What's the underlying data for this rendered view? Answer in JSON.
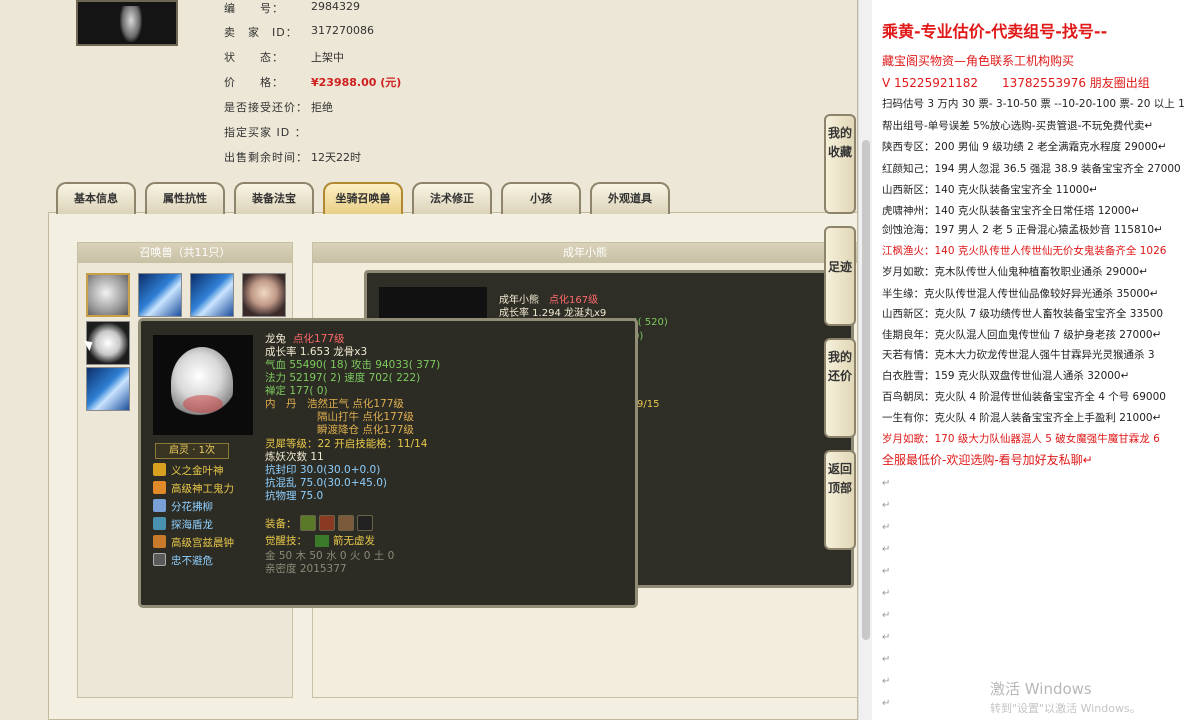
{
  "info": {
    "id_label": "编　　号：",
    "id_value": "2984329",
    "seller_label": "卖　家　ID：",
    "seller_value": "317270086",
    "status_label": "状　　态：",
    "status_value": "上架中",
    "price_label": "价　　格：",
    "price_value": "¥23988.00 (元)",
    "counter_label": "是否接受还价：",
    "counter_value": "拒绝",
    "buyer_label": "指定买家 ID ：",
    "buyer_value": "",
    "time_label": "出售剩余时间：",
    "time_value": "12天22时"
  },
  "tabs": [
    "基本信息",
    "属性抗性",
    "装备法宝",
    "坐骑召唤兽",
    "法术修正",
    "小孩",
    "外观道具"
  ],
  "pets": {
    "header": "召唤兽（共11只）"
  },
  "detail_header": "成年小熊",
  "back_tip": {
    "name": "成年小熊",
    "tag": "点化167级",
    "growth": "成长率 1.294 龙涎丸x9",
    "v1": "94( 520)",
    "v2": "0)",
    "v3": "9/15"
  },
  "tip": {
    "name": "龙兔",
    "tag": "点化177级",
    "growth": "成长率 1.653 龙骨x3",
    "hp": "气血 55490( 18) 攻击 94033( 377)",
    "mp": "法力 52197( 2) 速度 702( 222)",
    "shen": "禅定 177( 0)",
    "neidan_label": "内　丹",
    "neidan": [
      "浩然正气 点化177级",
      "隔山打牛 点化177级",
      "瞬渡降仓 点化177级"
    ],
    "ling": "灵犀等级：22 开启技能格：11/14",
    "lian": "炼妖次数 11",
    "k1": "抗封印 30.0(30.0+0.0)",
    "k2": "抗混乱 75.0(30.0+45.0)",
    "k3": "抗物理 75.0",
    "equip_label": "装备：",
    "awake_label": "觉醒技：",
    "awake_skill": "箭无虚发",
    "wux": "金 50 木 50 水 0 火 0 土 0",
    "qinmi": "亲密度 2015377",
    "qiling": "启灵 · 1次",
    "skills": [
      "义之金叶神",
      "高级神工鬼力",
      "分花拂柳",
      "探海盾龙",
      "高级宫兹晨钟",
      "忠不避危"
    ]
  },
  "side_buttons": [
    "我的收藏",
    "足迹",
    "我的还价",
    "返回顶部"
  ],
  "right": {
    "title": "乘黄-专业估价-代卖组号-找号--",
    "line1": "藏宝阁买物资—角色联系工机构购买",
    "line2": "V 15225921182　　13782553976 朋友圈出组",
    "lines": [
      "扫码估号 3 万内 30 票- 3-10-50 票 --10-20-100 票- 20 以上 1",
      "帮出组号-单号误差 5%放心选购-买贵管退-不玩免费代卖↵",
      "陕西专区：200 男仙 9 级功绩 2 老全满霜克水程度 29000↵",
      "红颜知己：194 男人忽混 36.5 强混 38.9 装备宝宝齐全 27000",
      "山西新区：140 克火队装备宝宝齐全 11000↵",
      "虎啸神州：140 克火队装备宝宝齐全日常任塔 12000↵",
      "剑蚀沧海：197 男人 2 老 5 正骨混心猿孟极妙音 115810↵",
      "江枫渔火：140 克火队传世人传世仙无价女鬼装备齐全 1026",
      "岁月如歌：克木队传世人仙鬼种植畜牧职业通杀 29000↵",
      "半生缘：克火队传世混人传世仙品像较好异光通杀 35000↵",
      "山西新区：克火队 7 级功绩传世人畜牧装备宝宝齐全 33500",
      "佳期良年：克火队混人回血鬼传世仙 7 级护身老孩 27000↵",
      "天若有情：克木大力砍龙传世混人强牛甘霖异光灵猴通杀 3",
      "白衣胜雪：159 克火队双盘传世仙混人通杀 32000↵",
      "百鸟朝凤：克火队 4 阶混传世仙装备宝宝齐全 4 个号 69000",
      "一生有你：克火队 4 阶混人装备宝宝齐全上手盈利 21000↵",
      "岁月如歌：170 级大力队仙器混人 5 破女魔强牛魔甘霖龙 6",
      "全服最低价-欢迎选购-看号加好友私聊↵"
    ],
    "watermark": "激活 Windows",
    "watermark2": "转到\"设置\"以激活 Windows。"
  }
}
